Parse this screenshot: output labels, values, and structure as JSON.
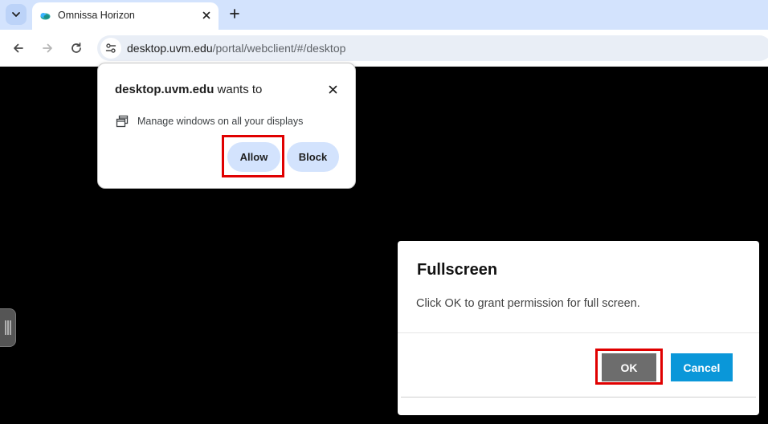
{
  "browser": {
    "tab": {
      "title": "Omnissa Horizon"
    },
    "address": {
      "host": "desktop.uvm.edu",
      "path": "/portal/webclient/#/desktop"
    }
  },
  "permission_prompt": {
    "origin": "desktop.uvm.edu",
    "wants_to": " wants to",
    "item_label": "Manage windows on all your displays",
    "allow_label": "Allow",
    "block_label": "Block"
  },
  "fullscreen_dialog": {
    "title": "Fullscreen",
    "message": "Click OK to grant permission for full screen.",
    "ok_label": "OK",
    "cancel_label": "Cancel"
  },
  "colors": {
    "tabstrip": "#d3e3fd",
    "omnibox": "#e9eef6",
    "pill_button": "#d3e3fd",
    "ok_button": "#6d6d6d",
    "cancel_button": "#0a97d9",
    "highlight": "#e00000"
  },
  "icons": {
    "tab_search": "chevron-down-icon",
    "favicon": "omnissa-cloud-icon",
    "tab_close": "close-icon",
    "new_tab": "plus-icon",
    "back": "arrow-left-icon",
    "forward": "arrow-right-icon",
    "reload": "reload-icon",
    "site_info": "tune-icon",
    "prompt_close": "close-icon",
    "window_management": "windows-icon",
    "side_handle": "grip-icon"
  }
}
